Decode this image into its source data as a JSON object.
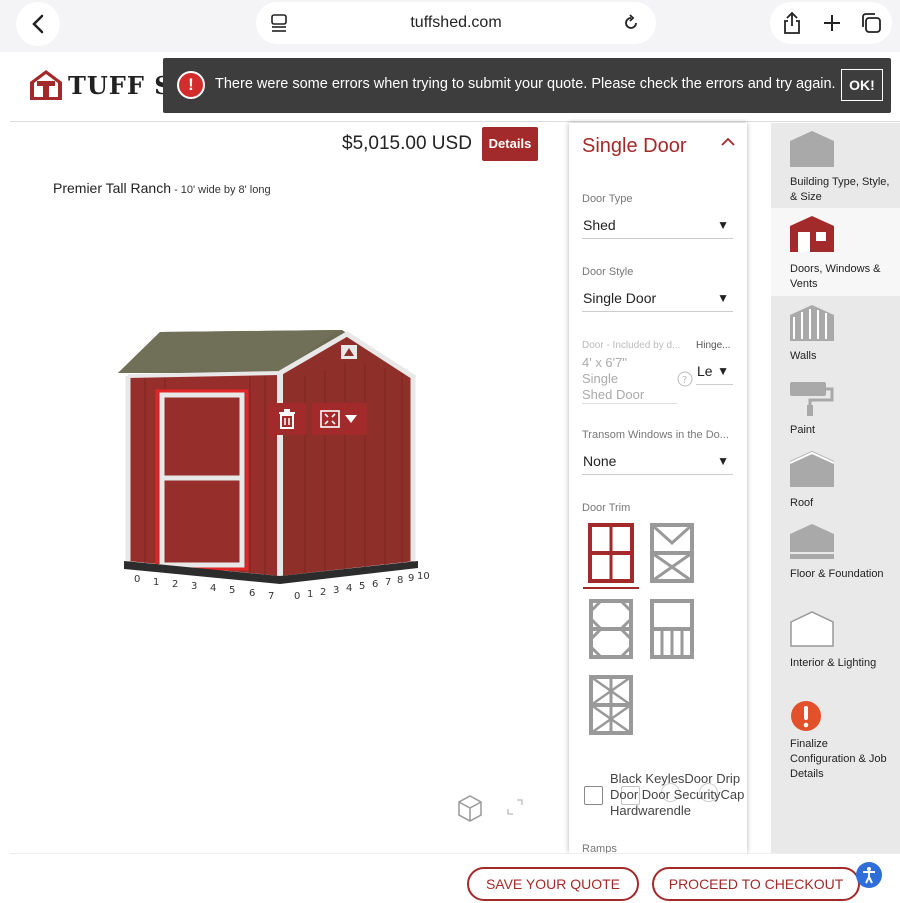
{
  "browser": {
    "url": "tuffshed.com"
  },
  "header": {
    "logo_text": "TUFF SHED"
  },
  "error_banner": {
    "message": "There were some errors when trying to submit your quote. Please check the errors and try again.",
    "ok_label": "OK!"
  },
  "viewer": {
    "price": "$5,015.00 USD",
    "details_label": "Details",
    "shed_name": "Premier Tall Ranch",
    "shed_size": " - 10' wide by 8' long",
    "ruler_left": [
      "0",
      "1",
      "2",
      "3",
      "4",
      "5",
      "6",
      "7"
    ],
    "ruler_right": [
      "0",
      "1",
      "2",
      "3",
      "4",
      "5",
      "6",
      "7",
      "8",
      "9",
      "10"
    ]
  },
  "panel": {
    "title": "Single Door",
    "door_type_label": "Door Type",
    "door_type_value": "Shed",
    "door_style_label": "Door Style",
    "door_style_value": "Single Door",
    "door_included_label": "Door - Included by d...",
    "door_included_value_lines": [
      "4' x 6'7\"",
      "Single",
      "Shed Door"
    ],
    "hinge_label": "Hinge...",
    "hinge_value": "Le",
    "transom_label": "Transom Windows in the Do...",
    "transom_value": "None",
    "trim_label": "Door Trim",
    "checkbox_overlap_lines": [
      "Black KeylesDoor Drip",
      "Door  Door  SecurityCap",
      "Hardwarendle"
    ],
    "ramps_label": "Ramps"
  },
  "nav": {
    "items": [
      {
        "label": "Building Type, Style, & Size",
        "icon": "building-icon",
        "active": false
      },
      {
        "label": "Doors, Windows & Vents",
        "icon": "door-window-icon",
        "active": true
      },
      {
        "label": "Walls",
        "icon": "walls-icon",
        "active": false
      },
      {
        "label": "Paint",
        "icon": "paint-roller-icon",
        "active": false
      },
      {
        "label": "Roof",
        "icon": "roof-icon",
        "active": false
      },
      {
        "label": "Floor & Foundation",
        "icon": "floor-icon",
        "active": false
      },
      {
        "label": "Interior & Lighting",
        "icon": "interior-icon",
        "active": false
      },
      {
        "label": "Finalize Configuration & Job Details",
        "icon": "error-icon",
        "active": false
      }
    ]
  },
  "bottom": {
    "save_label": "SAVE YOUR QUOTE",
    "checkout_label": "PROCEED TO CHECKOUT"
  },
  "colors": {
    "brand": "#a32a2a",
    "error": "#d22c2c",
    "banner": "#3d3d3d"
  }
}
